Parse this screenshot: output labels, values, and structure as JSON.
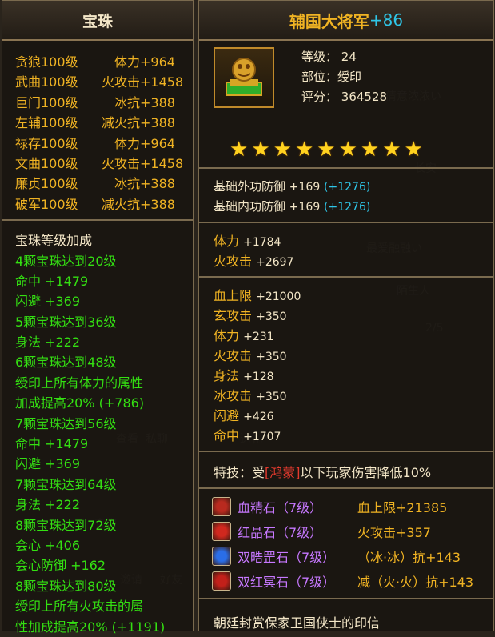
{
  "background_text": [
    "倩意浓浓い",
    "长安",
    "最爱融融い",
    "陌生人",
    "2/5",
    "查看",
    "私聊",
    "送礼",
    "查询",
    "邀请",
    "好友"
  ],
  "left": {
    "title": "宝珠",
    "rows": [
      {
        "name": "贪狼100级",
        "attr": "体力",
        "value": "+964"
      },
      {
        "name": "武曲100级",
        "attr": "火攻击",
        "value": "+1458"
      },
      {
        "name": "巨门100级",
        "attr": "冰抗",
        "value": "+388"
      },
      {
        "name": "左辅100级",
        "attr": "减火抗",
        "value": "+388"
      },
      {
        "name": "禄存100级",
        "attr": "体力",
        "value": "+964"
      },
      {
        "name": "文曲100级",
        "attr": "火攻击",
        "value": "+1458"
      },
      {
        "name": "廉贞100级",
        "attr": "冰抗",
        "value": "+388"
      },
      {
        "name": "破军100级",
        "attr": "减火抗",
        "value": "+388"
      }
    ],
    "bonus_title": "宝珠等级加成",
    "bonus_lines": [
      "4颗宝珠达到20级",
      "命中 +1479",
      "闪避 +369",
      "5颗宝珠达到36级",
      "身法 +222",
      "6颗宝珠达到48级",
      "绶印上所有体力的属性",
      "加成提高20% (+786)",
      "7颗宝珠达到56级",
      "命中 +1479",
      "闪避 +369",
      "7颗宝珠达到64级",
      "身法 +222",
      "8颗宝珠达到72级",
      "会心 +406",
      "会心防御 +162",
      "8颗宝珠达到80级",
      "绶印上所有火攻击的属",
      "性加成提高20% (+1191)"
    ]
  },
  "right": {
    "title": "辅国大将军",
    "title_plus": "+86",
    "level_label": "等级：",
    "level": "24",
    "slot_label": "部位：",
    "slot": "绶印",
    "score_label": "评分：",
    "score": "364528",
    "star_count": 9,
    "base": [
      {
        "name": "基础外功防御",
        "value": "+169",
        "extra": "(+1276)"
      },
      {
        "name": "基础内功防御",
        "value": "+169",
        "extra": "(+1276)"
      }
    ],
    "main_attrs": [
      {
        "name": "体力",
        "value": "+1784"
      },
      {
        "name": "火攻击",
        "value": "+2697"
      }
    ],
    "extra_attrs": [
      {
        "name": "血上限",
        "value": "+21000"
      },
      {
        "name": "玄攻击",
        "value": "+350"
      },
      {
        "name": "体力",
        "value": "+231"
      },
      {
        "name": "火攻击",
        "value": "+350"
      },
      {
        "name": "身法",
        "value": "+128"
      },
      {
        "name": "冰攻击",
        "value": "+350"
      },
      {
        "name": "闪避",
        "value": "+426"
      },
      {
        "name": "命中",
        "value": "+1707"
      }
    ],
    "skill_prefix": "特技：受",
    "skill_highlight": "[鸿蒙]",
    "skill_suffix": "以下玩家伤害降低",
    "skill_value": "10%",
    "gems": [
      {
        "name": "血精石（7级）",
        "effect": "血上限+21385",
        "color": "#b92a1f",
        "icon": "blood-gem-icon"
      },
      {
        "name": "红晶石（7级）",
        "effect": "火攻击+357",
        "color": "#d0281e",
        "icon": "red-crystal-icon"
      },
      {
        "name": "双晧罡石（7级）",
        "effect": "（冰·冰）抗+143",
        "color": "#2a6ee8",
        "icon": "blue-gem-icon"
      },
      {
        "name": "双红冥石（7级）",
        "effect": "减（火·火）抗+143",
        "color": "#c2201a",
        "icon": "red-dark-gem-icon"
      }
    ],
    "description": "朝廷封赏保家卫国侠士的印信"
  }
}
